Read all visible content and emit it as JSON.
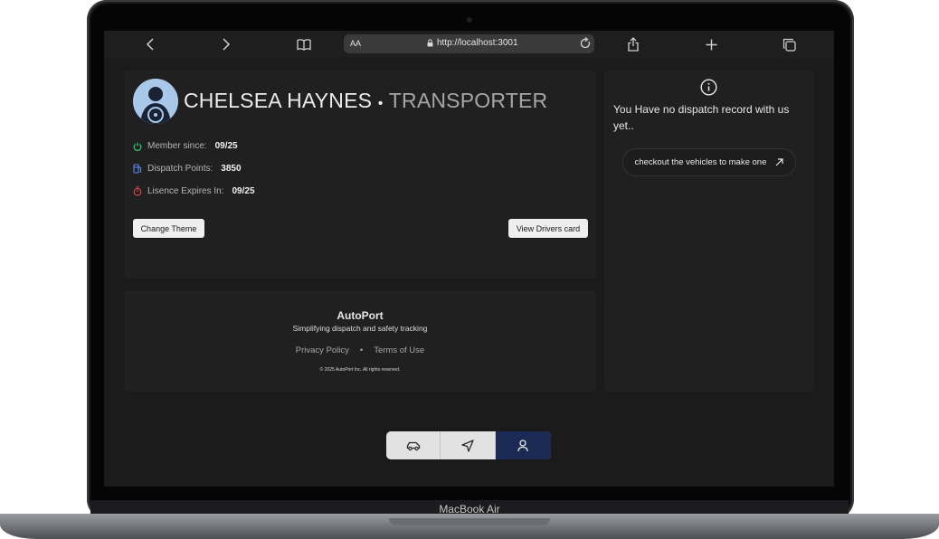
{
  "browser": {
    "url": "http://localhost:3001",
    "text_size_label": "AA"
  },
  "profile": {
    "name": "CHELSEA HAYNES",
    "separator": "•",
    "role": "TRANSPORTER",
    "stats": [
      {
        "label": "Member since:",
        "value": "09/25",
        "icon": "power-icon",
        "color": "#2ec76d"
      },
      {
        "label": "Dispatch Points:",
        "value": "3850",
        "icon": "fuel-icon",
        "color": "#5b8def"
      },
      {
        "label": "Lisence Expires In:",
        "value": "09/25",
        "icon": "timer-icon",
        "color": "#e24b4b"
      }
    ],
    "change_theme_label": "Change Theme",
    "view_card_label": "View Drivers card"
  },
  "dispatch": {
    "empty_message": "You Have no dispatch record with us yet..",
    "cta_label": "checkout the vehicles to make one"
  },
  "footer": {
    "brand": "AutoPort",
    "tagline": "Simplifying dispatch and safety tracking",
    "links": [
      "Privacy Policy",
      "•",
      "Terms of Use"
    ],
    "copyright": "© 2025 AutoPort Inc. All rights reserved."
  },
  "bottom_nav": {
    "items": [
      {
        "name": "vehicles",
        "icon": "car-icon"
      },
      {
        "name": "dispatch",
        "icon": "navigation-icon"
      },
      {
        "name": "profile",
        "icon": "user-icon",
        "active": true
      }
    ],
    "active_color": "#1b2a55"
  },
  "device": {
    "model": "MacBook Air"
  }
}
